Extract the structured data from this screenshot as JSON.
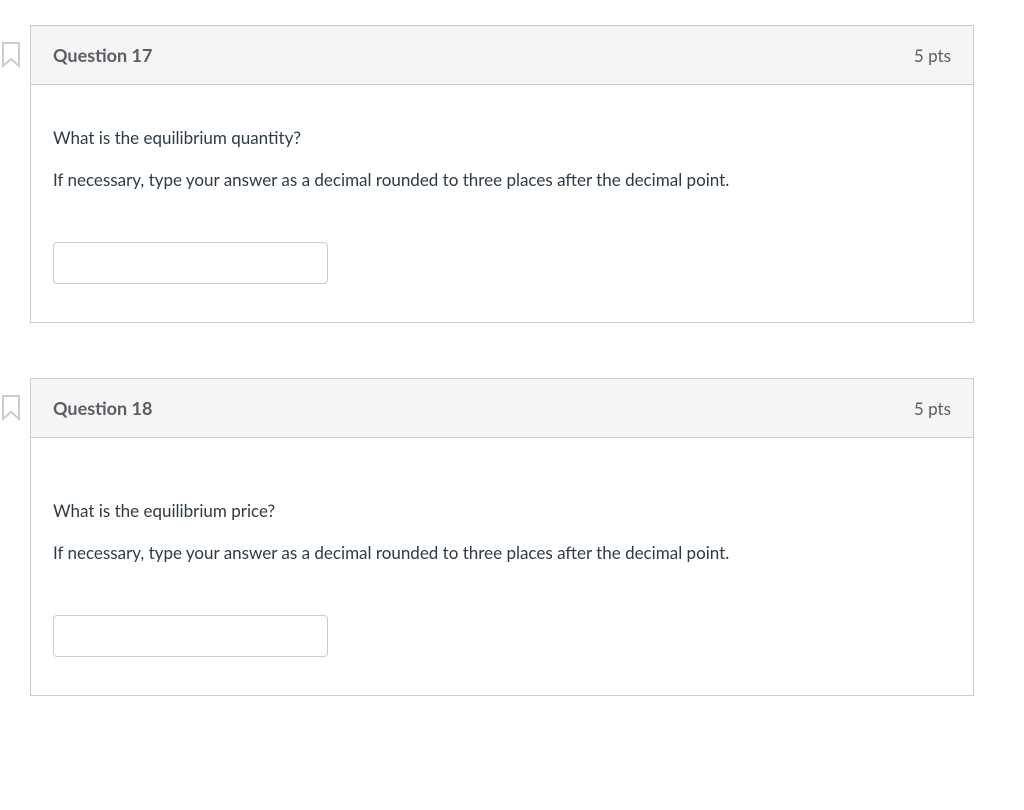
{
  "questions": [
    {
      "title": "Question 17",
      "points": "5 pts",
      "prompt": "What is the equilibrium quantity?",
      "hint": "If necessary, type your answer as a decimal rounded to three places after the decimal point.",
      "value": ""
    },
    {
      "title": "Question 18",
      "points": "5 pts",
      "prompt": "What is the equilibrium price?",
      "hint": "If necessary, type your answer as a decimal rounded to three places after the decimal point.",
      "value": ""
    }
  ]
}
